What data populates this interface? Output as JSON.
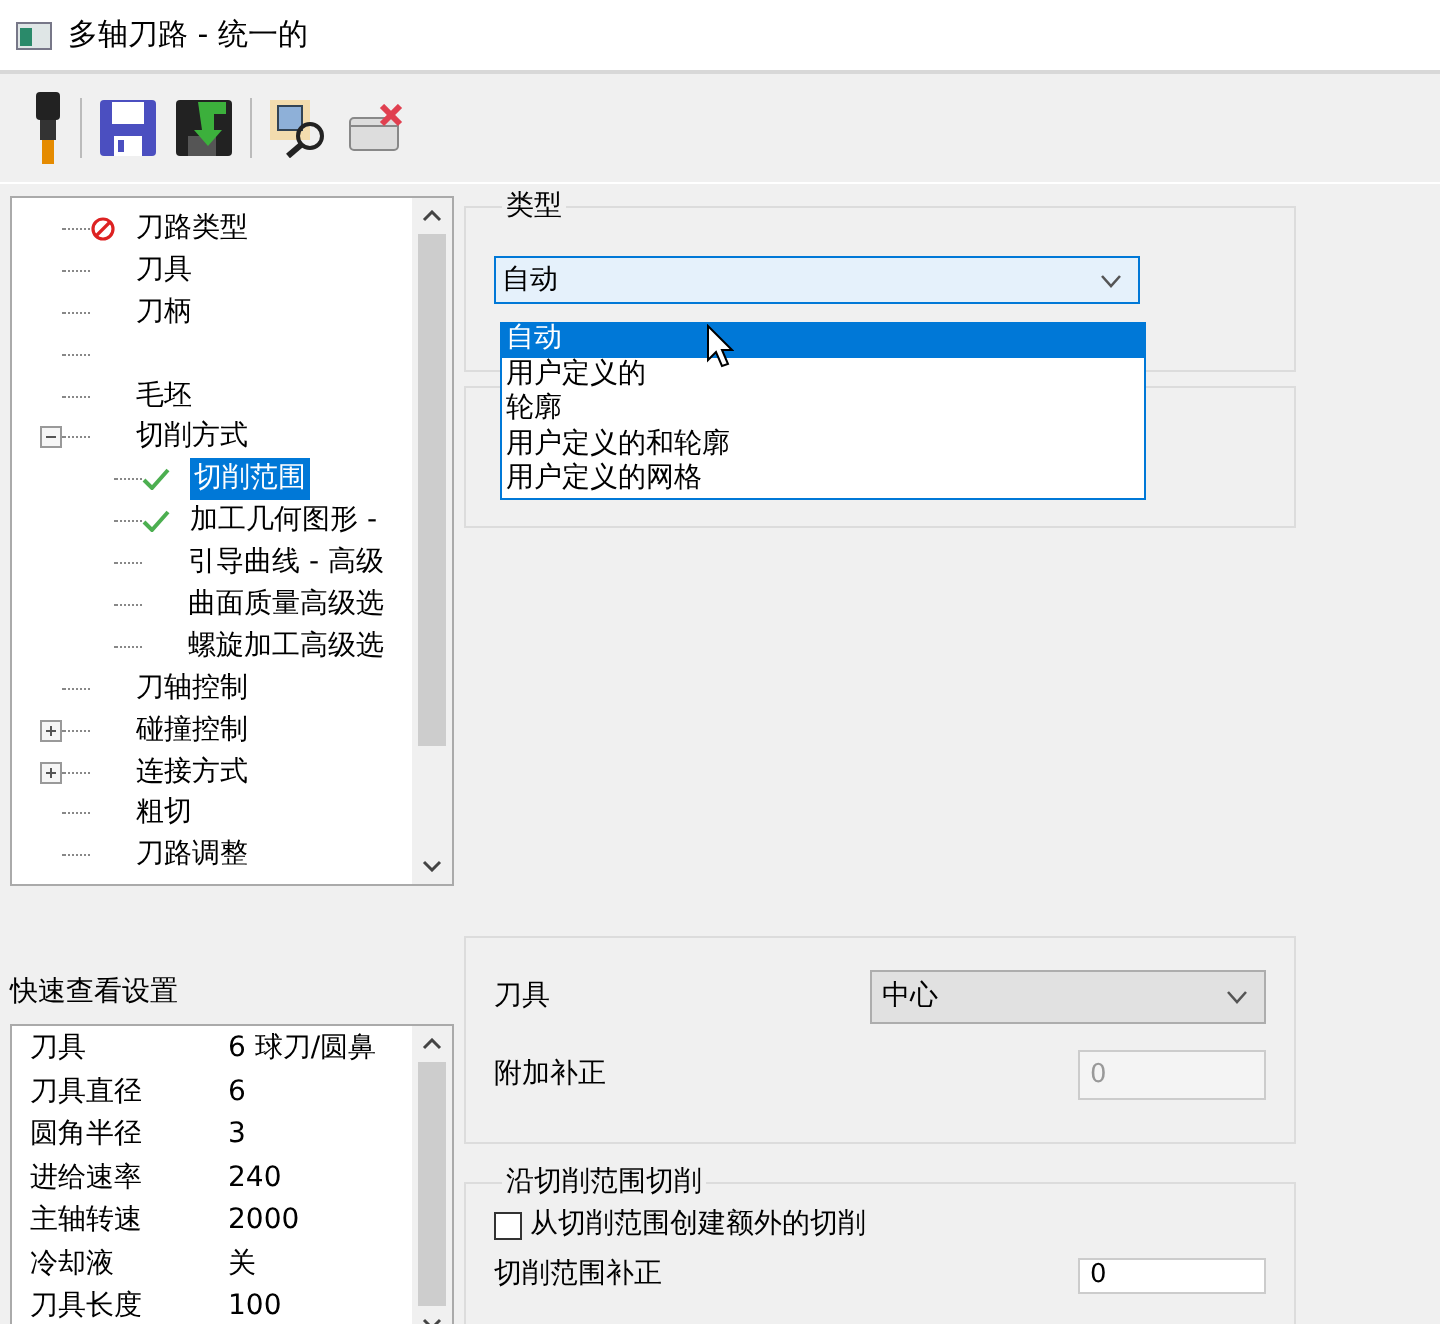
{
  "window": {
    "title": "多轴刀路 - 统一的"
  },
  "tree": {
    "items": [
      {
        "kind": "error",
        "label": "刀路类型"
      },
      {
        "kind": "plain",
        "label": "刀具"
      },
      {
        "kind": "plain",
        "label": "刀柄"
      },
      {
        "kind": "blank"
      },
      {
        "kind": "plain",
        "label": "毛坯"
      },
      {
        "kind": "plain",
        "label": "切削方式",
        "expanded": true,
        "children": [
          {
            "kind": "done",
            "label": "切削范围",
            "selected": true
          },
          {
            "kind": "done",
            "label": "加工几何图形 -",
            "selected": false
          },
          {
            "kind": "plain",
            "label": "引导曲线 - 高级",
            "selected": false
          },
          {
            "kind": "plain",
            "label": "曲面质量高级选",
            "selected": false
          },
          {
            "kind": "plain",
            "label": "螺旋加工高级选",
            "selected": false
          }
        ]
      },
      {
        "kind": "plain",
        "label": "刀轴控制"
      },
      {
        "kind": "plain",
        "label": "碰撞控制",
        "expanded": false
      },
      {
        "kind": "plain",
        "label": "连接方式",
        "expanded": false
      },
      {
        "kind": "plain",
        "label": "粗切"
      },
      {
        "kind": "plain",
        "label": "刀路调整"
      }
    ]
  },
  "quick_view": {
    "title": "快速查看设置",
    "rows": [
      {
        "name": "刀具",
        "value": "6 球刀/圆鼻"
      },
      {
        "name": "刀具直径",
        "value": "6"
      },
      {
        "name": "圆角半径",
        "value": "3"
      },
      {
        "name": "进给速率",
        "value": "240"
      },
      {
        "name": "主轴转速",
        "value": "2000"
      },
      {
        "name": "冷却液",
        "value": "关"
      },
      {
        "name": "刀具长度",
        "value": "100"
      }
    ]
  },
  "type_group": {
    "title": "类型",
    "dropdown": {
      "value": "自动",
      "expanded": true,
      "options": [
        {
          "label": "自动",
          "selected": true
        },
        {
          "label": "用户定义的",
          "selected": false
        },
        {
          "label": "轮廓",
          "selected": false
        },
        {
          "label": "用户定义的和轮廓",
          "selected": false
        },
        {
          "label": "用户定义的网格",
          "selected": false
        }
      ]
    }
  },
  "tool_group": {
    "fields": [
      {
        "kind": "select",
        "label": "刀具",
        "value": "中心",
        "disabled": false
      },
      {
        "kind": "number",
        "label": "附加补正",
        "value": "0",
        "disabled": true
      }
    ]
  },
  "cut_group": {
    "title": "沿切削范围切削",
    "checkbox": {
      "label": "从切削范围创建额外的切削",
      "checked": false
    },
    "field": {
      "label": "切削范围补正",
      "value": "0"
    }
  }
}
